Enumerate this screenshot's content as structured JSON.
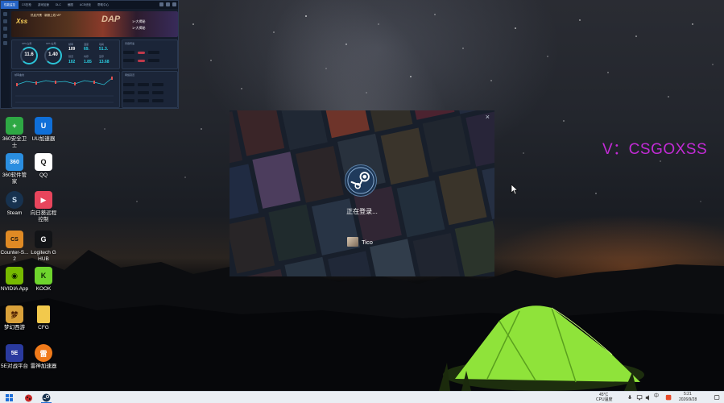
{
  "widget": {
    "tabs": [
      "性能监控",
      "CS压枪",
      "游戏加速",
      "DLC",
      "截图",
      "ACE优化",
      "帮助中心"
    ],
    "banner": {
      "brand": "Xss",
      "line1": "热血开黑 · 新服上线 VIP",
      "headline": "DAP",
      "line2": "1+大揭秘",
      "line3": "1+大揭秘"
    },
    "gauges": [
      {
        "value": "11.6",
        "label": "CPU占用"
      },
      {
        "value": "1.40",
        "label": "GPU占用"
      }
    ],
    "stats": [
      {
        "value": "109",
        "label": "帧率"
      },
      {
        "value": "69.",
        "label": "温度"
      },
      {
        "value": "51.3.",
        "label": "功耗"
      },
      {
        "value": "102",
        "label": "延迟"
      },
      {
        "value": "1.85",
        "label": "内存"
      },
      {
        "value": "13.68",
        "label": "显存"
      }
    ],
    "chart_label": "帧率曲线",
    "panel_right_label": "风扇转速",
    "panel_right2_label": "网络延迟"
  },
  "desktop_icons": [
    {
      "label": "360安全卫士",
      "icon": "shield-plus-icon",
      "color": "#2ea844",
      "glyph": "+"
    },
    {
      "label": "UU加速器",
      "icon": "uu-accelerator-icon",
      "color": "#0f6fd8",
      "glyph": "U"
    },
    {
      "label": "360软件管家",
      "icon": "360-manager-icon",
      "color": "#2a8ee0",
      "glyph": "360"
    },
    {
      "label": "QQ",
      "icon": "qq-penguin-icon",
      "color": "#ffffff",
      "glyph": "Q"
    },
    {
      "label": "Steam",
      "icon": "steam-icon",
      "color": "#17324f",
      "glyph": "S"
    },
    {
      "label": "向日葵远程控制",
      "icon": "sunflower-remote-icon",
      "color": "#e8455c",
      "glyph": "▶"
    },
    {
      "label": "Counter-S... 2",
      "icon": "counter-strike-icon",
      "color": "#e08a24",
      "glyph": "CS"
    },
    {
      "label": "Logitech G HUB",
      "icon": "logitech-g-icon",
      "color": "#121417",
      "glyph": "G"
    },
    {
      "label": "NVIDIA App",
      "icon": "nvidia-icon",
      "color": "#76b900",
      "glyph": "◉"
    },
    {
      "label": "KOOK",
      "icon": "kook-icon",
      "color": "#6ed42d",
      "glyph": "K"
    },
    {
      "label": "梦幻西游",
      "icon": "mhxy-game-icon",
      "color": "#d9a13a",
      "glyph": "梦"
    },
    {
      "label": "CFG",
      "icon": "folder-icon",
      "color": "#f2c94c",
      "glyph": ""
    },
    {
      "label": "5E对战平台",
      "icon": "5e-platform-icon",
      "color": "#2a3a9e",
      "glyph": "5E"
    },
    {
      "label": "雷神加速器",
      "icon": "leishen-accelerator-icon",
      "color": "#f07a1a",
      "glyph": "雷"
    }
  ],
  "steam_dialog": {
    "status": "正在登录...",
    "user": "Tico",
    "close": "×"
  },
  "watermark": "V：CSGOXSS",
  "taskbar": {
    "cpu_temp": "45°C",
    "cpu_label": "CPU温度",
    "time": "5:21",
    "date": "2026/9/28",
    "ime": "中"
  }
}
